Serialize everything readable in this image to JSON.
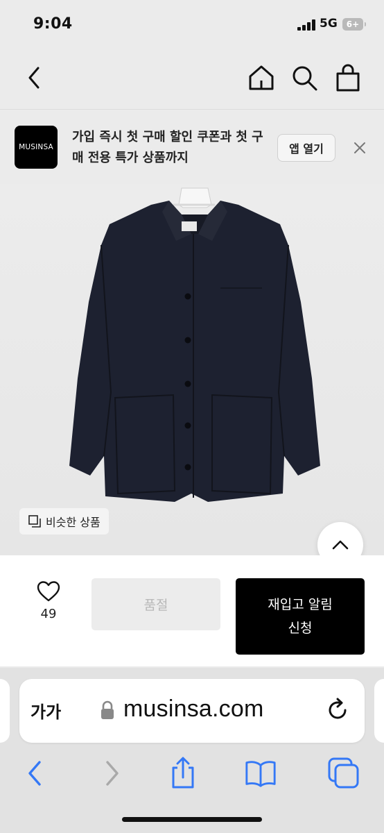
{
  "status_bar": {
    "time": "9:04",
    "network": "5G",
    "battery": "6+"
  },
  "header": {
    "icons": [
      "back-icon",
      "home-icon",
      "search-icon",
      "shopping-bag-icon"
    ]
  },
  "app_banner": {
    "logo_text": "MUSINSA",
    "message": "가입 즉시 첫 구매 할인 쿠폰과 첫 구매 전용 특가 상품까지",
    "open_app_label": "앱 열기"
  },
  "product": {
    "similar_label": "비슷한 상품",
    "like_count": "49",
    "soldout_label": "품절",
    "restock_label": "재입고 알림\n신청"
  },
  "browser": {
    "text_size_label": "가가",
    "url": "musinsa.com"
  },
  "colors": {
    "accent": "#3478f6",
    "primary_button": "#000000",
    "disabled_button": "#ececec"
  }
}
